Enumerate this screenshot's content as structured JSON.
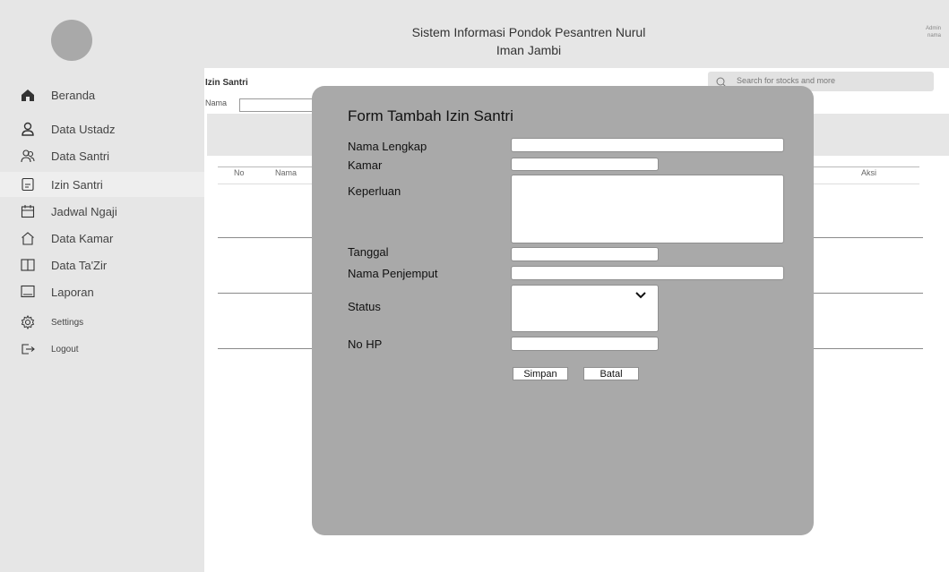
{
  "header": {
    "title_line1": "Sistem Informasi Pondok Pesantren Nurul",
    "title_line2": "Iman Jambi",
    "admin_line1": "Admin",
    "admin_line2": "nama"
  },
  "sidebar": {
    "items": [
      {
        "label": "Beranda",
        "icon": "home-icon"
      },
      {
        "label": "Data Ustadz",
        "icon": "user-icon"
      },
      {
        "label": "Data Santri",
        "icon": "users-icon"
      },
      {
        "label": "Izin Santri",
        "icon": "document-icon",
        "active": true
      },
      {
        "label": "Jadwal Ngaji",
        "icon": "calendar-icon"
      },
      {
        "label": "Data Kamar",
        "icon": "house-outline-icon"
      },
      {
        "label": "Data Ta'Zir",
        "icon": "book-icon"
      },
      {
        "label": "Laporan",
        "icon": "report-icon"
      },
      {
        "label": "Settings",
        "icon": "gear-icon"
      },
      {
        "label": "Logout",
        "icon": "logout-icon"
      }
    ]
  },
  "main": {
    "page_label": "Izin Santri",
    "search_placeholder": "Search for stocks and more",
    "filter_label": "Nama",
    "table_headers": [
      "No",
      "Nama",
      "Aksi"
    ]
  },
  "modal": {
    "title": "Form Tambah Izin Santri",
    "fields": {
      "nama_lengkap": "Nama Lengkap",
      "kamar": "Kamar",
      "keperluan": "Keperluan",
      "tanggal": "Tanggal",
      "nama_penjemput": "Nama Penjemput",
      "status": "Status",
      "no_hp": "No HP"
    },
    "save_label": "Simpan",
    "cancel_label": "Batal"
  }
}
